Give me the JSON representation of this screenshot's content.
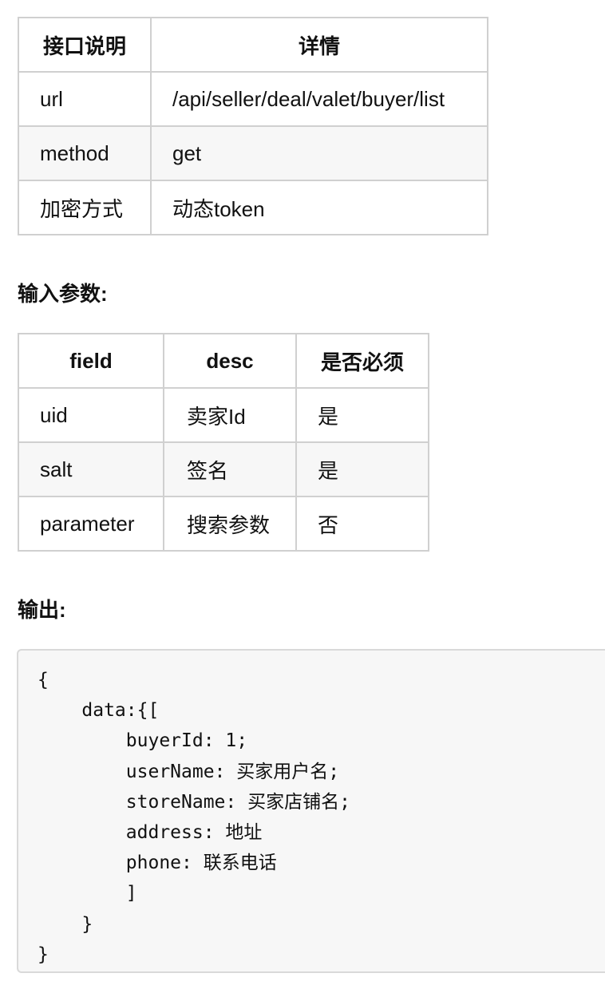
{
  "api_table": {
    "headers": [
      "接口说明",
      "详情"
    ],
    "rows": [
      [
        "url",
        "/api/seller/deal/valet/buyer/list"
      ],
      [
        "method",
        "get"
      ],
      [
        "加密方式",
        "动态token"
      ]
    ]
  },
  "input_section": {
    "heading": "输入参数:"
  },
  "params_table": {
    "headers": [
      "field",
      "desc",
      "是否必须"
    ],
    "rows": [
      [
        "uid",
        "卖家Id",
        "是"
      ],
      [
        "salt",
        "签名",
        "是"
      ],
      [
        "parameter",
        "搜索参数",
        "否"
      ]
    ]
  },
  "output_section": {
    "heading": "输出:",
    "code_lines": [
      "{",
      "    data:{[",
      "        buyerId: 1;",
      "        userName: 买家用户名;",
      "        storeName: 买家店铺名;",
      "        address: 地址",
      "        phone: 联系电话",
      "        ]",
      "    }",
      "}"
    ]
  }
}
